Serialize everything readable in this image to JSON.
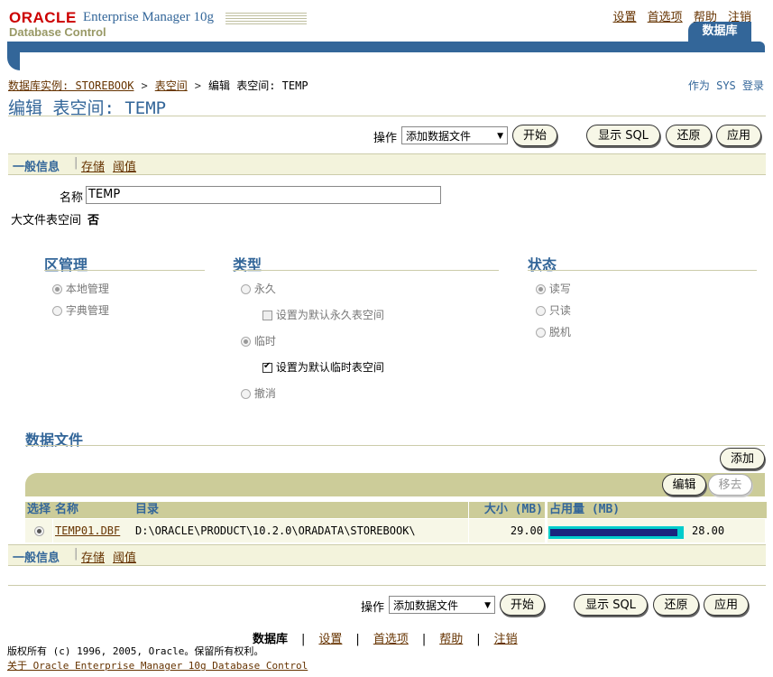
{
  "header": {
    "logo_oracle": "ORACLE",
    "logo_product": "Enterprise Manager 10g",
    "logo_sub": "Database Control",
    "global_links": [
      "设置",
      "首选项",
      "帮助",
      "注销"
    ],
    "active_tab": "数据库"
  },
  "breadcrumb": {
    "instance": "数据库实例: STOREBOOK",
    "tablespaces": "表空间",
    "current": "编辑 表空间: TEMP"
  },
  "login_info": "作为 SYS 登录",
  "page_title": "编辑 表空间: TEMP",
  "actions": {
    "label": "操作",
    "selected": "添加数据文件",
    "go": "开始",
    "show_sql": "显示 SQL",
    "revert": "还原",
    "apply": "应用"
  },
  "subtabs": [
    "一般信息",
    "存储",
    "阈值"
  ],
  "form": {
    "name_label": "名称",
    "name_value": "TEMP",
    "bigfile_label": "大文件表空间",
    "bigfile_value": "否"
  },
  "extent": {
    "title": "区管理",
    "options": [
      "本地管理",
      "字典管理"
    ],
    "selected": "本地管理"
  },
  "type": {
    "title": "类型",
    "permanent": "永久",
    "set_default_permanent": "设置为默认永久表空间",
    "temporary": "临时",
    "set_default_temporary": "设置为默认临时表空间",
    "undo": "撤消",
    "selected": "临时",
    "default_temporary_checked": true
  },
  "status": {
    "title": "状态",
    "options": [
      "读写",
      "只读",
      "脱机"
    ],
    "selected": "读写"
  },
  "datafiles": {
    "title": "数据文件",
    "add": "添加",
    "edit": "编辑",
    "remove": "移去",
    "columns": [
      "选择",
      "名称",
      "目录",
      "大小 (MB)",
      "占用量 (MB)"
    ],
    "rows": [
      {
        "name": "TEMP01.DBF",
        "directory": "D:\\ORACLE\\PRODUCT\\10.2.0\\ORADATA\\STOREBOOK\\",
        "size": "29.00",
        "used": "28.00",
        "used_fraction": 0.9655
      }
    ]
  },
  "footer": {
    "links": [
      "数据库",
      "设置",
      "首选项",
      "帮助",
      "注销"
    ],
    "copyright": "版权所有 (c) 1996, 2005, Oracle。保留所有权利。",
    "about": "关于 Oracle Enterprise Manager 10g Database Control"
  },
  "colors": {
    "brand_blue": "#336699",
    "band_tan": "#cccc99",
    "usage_bar": "#1a237e",
    "usage_bar_border": "#00cccc"
  }
}
